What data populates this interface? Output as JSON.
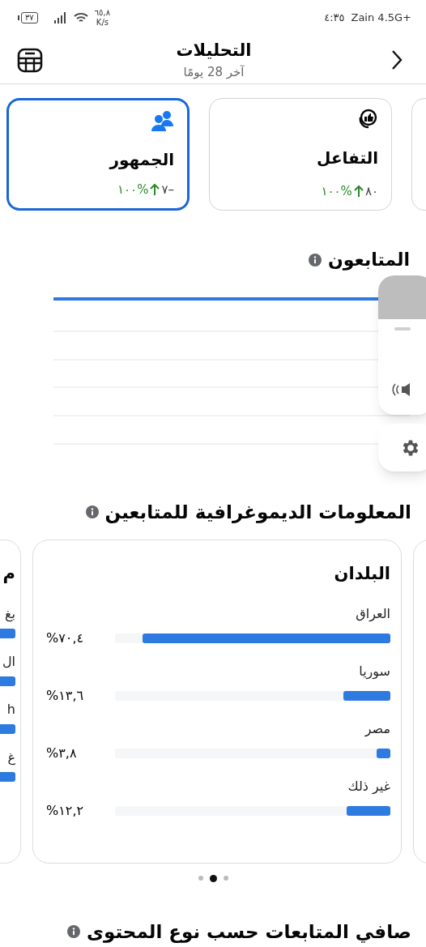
{
  "status_bar": {
    "carrier": "Zain 4.5G+",
    "time": "٤:٣٥",
    "network_speed": "٦٥,٨",
    "speed_unit": "K/s",
    "battery": "٣٧"
  },
  "header": {
    "title": "التحليلات",
    "subtitle": "آخر 28 يومًا"
  },
  "metric_cards": [
    {
      "kind": "engagement",
      "title": "التفاعل",
      "value": "٨٠",
      "change": "١٠٠%",
      "selected": false
    },
    {
      "kind": "audience",
      "title": "الجمهور",
      "value": "٧–",
      "change": "١٠٠%",
      "selected": true
    }
  ],
  "followers": {
    "title": "المتابعون"
  },
  "demographics": {
    "title": "المعلومات الديموغرافية للمتابعين",
    "side_card": {
      "title": "م",
      "rows": [
        {
          "label": "بغ"
        },
        {
          "label": "ال"
        },
        {
          "label": "h"
        },
        {
          "label": "غ"
        }
      ]
    },
    "countries_card": {
      "title": "البلدان",
      "rows": [
        {
          "label": "العراق",
          "value": "%٧٠,٤",
          "level": 0.9
        },
        {
          "label": "سوريا",
          "value": "%١٣,٦",
          "level": 0.17
        },
        {
          "label": "مصر",
          "value": "%٣,٨",
          "level": 0.05
        },
        {
          "label": "غير ذلك",
          "value": "%١٢,٢",
          "level": 0.16
        }
      ]
    },
    "pages": [
      {
        "selected": false
      },
      {
        "selected": true
      },
      {
        "selected": false
      }
    ]
  },
  "next_section": {
    "title": "صافي المتابعات حسب نوع المحتوى"
  }
}
